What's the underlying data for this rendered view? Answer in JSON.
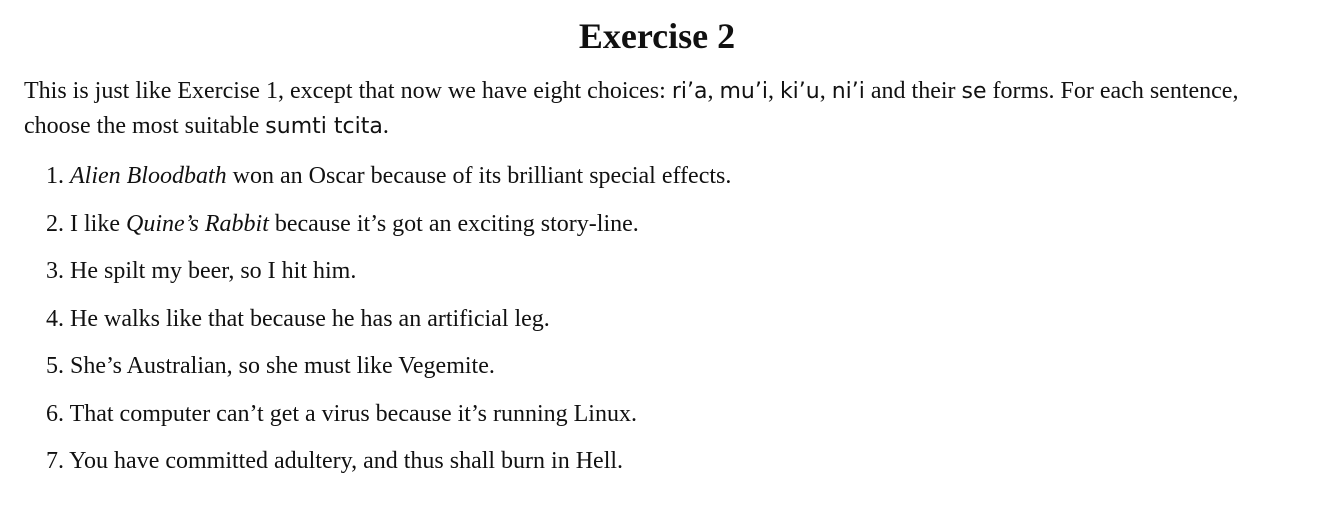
{
  "title": "Exercise 2",
  "intro": {
    "t1": "This is just like Exercise 1, except that now we have eight choices: ",
    "c1": "ri’a",
    "s1": ", ",
    "c2": "mu’i",
    "s2": ", ",
    "c3": "ki’u",
    "s3": ", ",
    "c4": "ni’i",
    "t2": " and their ",
    "c5": "se",
    "t3": " forms. For each sentence, choose the most suitable ",
    "c6": "sumti tcita",
    "t4": "."
  },
  "items": [
    {
      "num": "1.",
      "pre": " ",
      "em": "Alien Bloodbath",
      "post": " won an Oscar because of its brilliant special effects."
    },
    {
      "num": "2.",
      "pre": " I like ",
      "em": "Quine’s Rabbit",
      "post": " because it’s got an exciting story-line."
    },
    {
      "num": "3.",
      "text": " He spilt my beer, so I hit him."
    },
    {
      "num": "4.",
      "text": " He walks like that because he has an artificial leg."
    },
    {
      "num": "5.",
      "text": " She’s Australian, so she must like Vegemite."
    },
    {
      "num": "6.",
      "text": " That computer can’t get a virus because it’s running Linux."
    },
    {
      "num": "7.",
      "text": " You have committed adultery, and thus shall burn in Hell."
    }
  ]
}
